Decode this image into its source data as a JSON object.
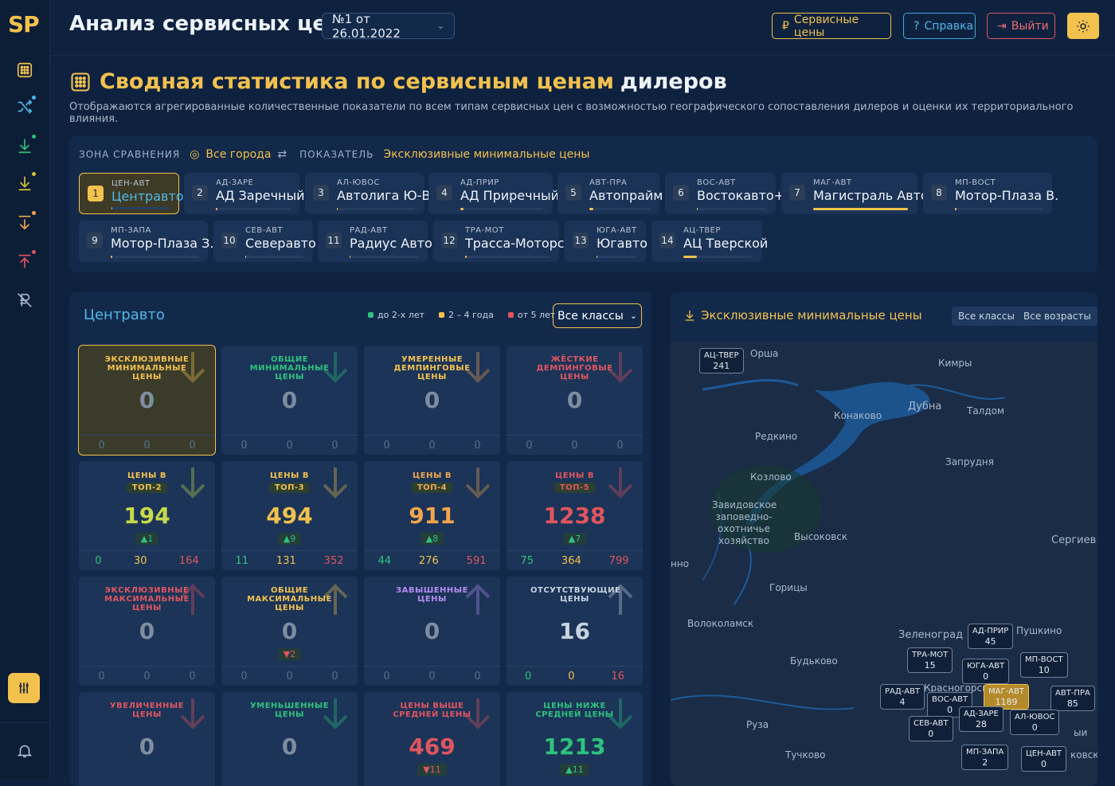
{
  "app": {
    "logo": "SP",
    "title": "Анализ сервисных цен",
    "doc": "№1 от 26.01.2022"
  },
  "header_buttons": {
    "prices": "Сервисные цены",
    "help": "Справка",
    "exit": "Выйти"
  },
  "page": {
    "title_a": "Сводная статистика по сервисным ценам",
    "title_b": "дилеров",
    "desc": "Отображаются агрегированные количественные показатели по всем типам сервисных цен с возможностью географического сопоставления дилеров и оценки их территориального влияния."
  },
  "zone": {
    "label": "ЗОНА СРАВНЕНИЯ",
    "value": "Все города",
    "indicator_label": "ПОКАЗАТЕЛЬ",
    "indicator": "Эксклюзивные минимальные цены"
  },
  "dealers": [
    {
      "n": "1",
      "code": "ЦЕН-АВТ",
      "name": "Центравто",
      "bar": 0.0
    },
    {
      "n": "2",
      "code": "АД-ЗАРЕ",
      "name": "АД Заречный",
      "bar": 0.02
    },
    {
      "n": "3",
      "code": "АЛ-ЮВОС",
      "name": "Автолига Ю-В",
      "bar": 0.0
    },
    {
      "n": "4",
      "code": "АД-ПРИР",
      "name": "АД Приречный",
      "bar": 0.04
    },
    {
      "n": "5",
      "code": "АВТ-ПРА",
      "name": "Автопрайм",
      "bar": 0.07
    },
    {
      "n": "6",
      "code": "ВОС-АВТ",
      "name": "Востокавто+",
      "bar": 0.0
    },
    {
      "n": "7",
      "code": "МАГ-АВТ",
      "name": "Магистраль Авто",
      "bar": 1.0
    },
    {
      "n": "8",
      "code": "МП-ВОСТ",
      "name": "Мотор-Плаза В.",
      "bar": 0.0
    },
    {
      "n": "9",
      "code": "МП-ЗАПА",
      "name": "Мотор-Плаза З.",
      "bar": 0.0
    },
    {
      "n": "10",
      "code": "СЕВ-АВТ",
      "name": "Северавто",
      "bar": 0.0
    },
    {
      "n": "11",
      "code": "РАД-АВТ",
      "name": "Радиус Авто",
      "bar": 0.0
    },
    {
      "n": "12",
      "code": "ТРА-МОТ",
      "name": "Трасса-Моторс",
      "bar": 0.01
    },
    {
      "n": "13",
      "code": "ЮГА-АВТ",
      "name": "Югавто",
      "bar": 0.0
    },
    {
      "n": "14",
      "code": "АЦ-ТВЕР",
      "name": "АЦ Тверской",
      "bar": 0.2
    }
  ],
  "stats": {
    "dealer": "Центравто",
    "legend": [
      "до 2-х лет",
      "2 – 4 года",
      "от 5 лет"
    ],
    "class_select": "Все классы",
    "tiles": [
      {
        "label": "ЭКСКЛЮЗИВНЫЕ МИНИМАЛЬНЫЕ ЦЕНЫ",
        "value": "0",
        "delta": "",
        "sub": [
          "0",
          "0",
          "0"
        ]
      },
      {
        "label": "ОБЩИЕ МИНИМАЛЬНЫЕ ЦЕНЫ",
        "value": "0",
        "delta": "",
        "sub": [
          "0",
          "0",
          "0"
        ]
      },
      {
        "label": "УМЕРЕННЫЕ ДЕМПИНГОВЫЕ ЦЕНЫ",
        "value": "0",
        "delta": "",
        "sub": [
          "0",
          "0",
          "0"
        ]
      },
      {
        "label": "ЖЁСТКИЕ ДЕМПИНГОВЫЕ ЦЕНЫ",
        "value": "0",
        "delta": "",
        "sub": [
          "0",
          "0",
          "0"
        ]
      },
      {
        "label": "ЦЕНЫ В",
        "label2": "ТОП-2",
        "value": "194",
        "delta": "▲1",
        "sub": [
          "0",
          "30",
          "164"
        ]
      },
      {
        "label": "ЦЕНЫ В",
        "label2": "ТОП-3",
        "value": "494",
        "delta": "▲9",
        "sub": [
          "11",
          "131",
          "352"
        ]
      },
      {
        "label": "ЦЕНЫ В",
        "label2": "ТОП-4",
        "value": "911",
        "delta": "▲8",
        "sub": [
          "44",
          "276",
          "591"
        ]
      },
      {
        "label": "ЦЕНЫ В",
        "label2": "ТОП-5",
        "value": "1238",
        "delta": "▲7",
        "sub": [
          "75",
          "364",
          "799"
        ]
      },
      {
        "label": "ЭКСКЛЮЗИВНЫЕ МАКСИМАЛЬНЫЕ ЦЕНЫ",
        "value": "0",
        "delta": "",
        "sub": [
          "0",
          "0",
          "0"
        ]
      },
      {
        "label": "ОБЩИЕ МАКСИМАЛЬНЫЕ ЦЕНЫ",
        "value": "0",
        "delta": "▼2",
        "sub": [
          "0",
          "0",
          "0"
        ]
      },
      {
        "label": "ЗАВЫШЕННЫЕ ЦЕНЫ",
        "value": "0",
        "delta": "",
        "sub": [
          "0",
          "0",
          "0"
        ]
      },
      {
        "label": "ОТСУТСТВУЮЩИЕ ЦЕНЫ",
        "value": "16",
        "delta": "",
        "sub": [
          "0",
          "0",
          "16"
        ]
      },
      {
        "label": "УВЕЛИЧЕННЫЕ ЦЕНЫ",
        "value": "0",
        "delta": "",
        "sub": []
      },
      {
        "label": "УМЕНЬШЕННЫЕ ЦЕНЫ",
        "value": "0",
        "delta": "",
        "sub": []
      },
      {
        "label": "ЦЕНЫ ВЫШЕ СРЕДНЕЙ ЦЕНЫ",
        "value": "469",
        "delta": "▼11",
        "sub": []
      },
      {
        "label": "ЦЕНЫ НИЖЕ СРЕДНЕЙ ЦЕНЫ",
        "value": "1213",
        "delta": "▲11",
        "sub": []
      }
    ]
  },
  "map": {
    "title": "Эксклюзивные минимальные цены",
    "btn_classes": "Все классы",
    "btn_ages": "Все возрасты",
    "places": [
      "Орша",
      "Кимры",
      "Дубна",
      "Талдом",
      "Конаково",
      "Редкино",
      "Запрудня",
      "Козлово",
      "Завидовское заповедно-охотничье хозяйство",
      "Высоковск",
      "Сергиев П",
      "Горицы",
      "Волоколамск",
      "Зеленоград",
      "Пушкино",
      "Будьково",
      "Руза",
      "Тучково",
      "Красногорск",
      "нно",
      "ковск",
      "ыи"
    ],
    "markers": [
      {
        "code": "АЦ-ТВЕР",
        "value": "241"
      },
      {
        "code": "АД-ПРИР",
        "value": "45"
      },
      {
        "code": "ТРА-МОТ",
        "value": "15"
      },
      {
        "code": "ЮГА-АВТ",
        "value": "0"
      },
      {
        "code": "МП-ВОСТ",
        "value": "10"
      },
      {
        "code": "РАД-АВТ",
        "value": "4"
      },
      {
        "code": "МАГ-АВТ",
        "value": "1189"
      },
      {
        "code": "АВТ-ПРА",
        "value": "85"
      },
      {
        "code": "ВОС-АВТ",
        "value": "0"
      },
      {
        "code": "АД-ЗАРЕ",
        "value": "28"
      },
      {
        "code": "АЛ-ЮВОС",
        "value": "0"
      },
      {
        "code": "СЕВ-АВТ",
        "value": "0"
      },
      {
        "code": "МП-ЗАПА",
        "value": "2"
      },
      {
        "code": "ЦЕН-АВТ",
        "value": "0"
      }
    ]
  },
  "colors": {
    "accent": "#f2c14e",
    "blue": "#4fb8e8",
    "green": "#2ec27e",
    "red": "#e0555f",
    "yellow": "#f2c14e"
  }
}
